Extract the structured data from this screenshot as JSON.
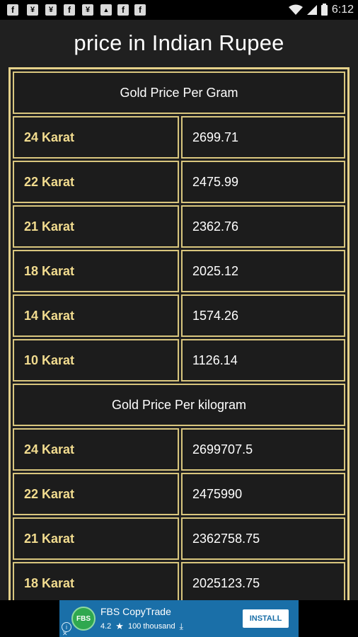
{
  "status_bar": {
    "time": "6:12",
    "left_icons": [
      "facebook-icon",
      "twitter-icon",
      "twitter-icon",
      "facebook-icon",
      "twitter-icon",
      "image-icon",
      "facebook-icon",
      "facebook-icon"
    ],
    "right_icons": [
      "wifi-icon",
      "signal-icon",
      "battery-icon"
    ]
  },
  "header": {
    "title": "price in Indian Rupee"
  },
  "table": {
    "sections": [
      {
        "title": "Gold Price Per Gram",
        "rows": [
          {
            "label": "24 Karat",
            "value": "2699.71"
          },
          {
            "label": "22 Karat",
            "value": "2475.99"
          },
          {
            "label": "21 Karat",
            "value": "2362.76"
          },
          {
            "label": "18 Karat",
            "value": "2025.12"
          },
          {
            "label": "14 Karat",
            "value": "1574.26"
          },
          {
            "label": "10 Karat",
            "value": "1126.14"
          }
        ]
      },
      {
        "title": "Gold Price Per kilogram",
        "rows": [
          {
            "label": "24 Karat",
            "value": "2699707.5"
          },
          {
            "label": "22 Karat",
            "value": "2475990"
          },
          {
            "label": "21 Karat",
            "value": "2362758.75"
          },
          {
            "label": "18 Karat",
            "value": "2025123.75"
          }
        ]
      }
    ]
  },
  "ad": {
    "logo_text": "FBS",
    "app_name": "FBS CopyTrade",
    "rating": "4.2",
    "downloads": "100 thousand",
    "install_label": "INSTALL",
    "info_icon": "i",
    "close_icon": "✕"
  },
  "colors": {
    "background": "#202020",
    "border_gold": "#e5d18a",
    "label_gold": "#f2dc8f",
    "ad_blue": "#1a6fa8"
  }
}
